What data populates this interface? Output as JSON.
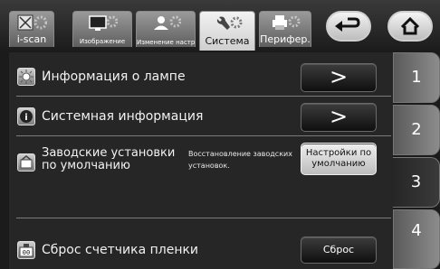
{
  "tabs": [
    {
      "label": "i-scan",
      "icon": "scan-icon",
      "active": false
    },
    {
      "label": "Изображение",
      "icon": "monitor-icon",
      "active": false
    },
    {
      "label": "Изменение настроек",
      "icon": "user-settings-icon",
      "active": false
    },
    {
      "label": "Система",
      "icon": "wrench-icon",
      "active": true
    },
    {
      "label": "Перифер.",
      "icon": "printer-icon",
      "active": false
    }
  ],
  "nav": {
    "back_icon": "back-arrow-icon",
    "home_icon": "home-icon"
  },
  "rows": [
    {
      "icon": "lamp-icon",
      "label": "Информация о лампе",
      "button": ">"
    },
    {
      "icon": "info-icon",
      "label": "Системная информация",
      "button": ">"
    },
    {
      "icon": "factory-reset-icon",
      "label": "Заводские установки по умолчанию",
      "description": "Восстановление заводских установок.",
      "button": "Настройки по умолчанию"
    },
    {
      "icon": "film-counter-icon",
      "label": "Сброс счетчика пленки",
      "button": "Сброс"
    }
  ],
  "pages": [
    "1",
    "2",
    "3",
    "4"
  ],
  "active_page": "3"
}
